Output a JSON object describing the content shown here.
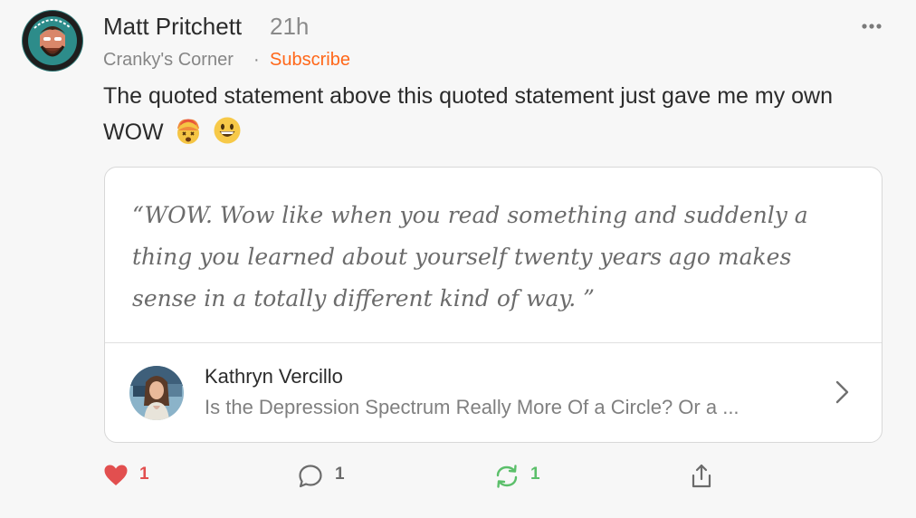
{
  "post": {
    "author": "Matt Pritchett",
    "timestamp": "21h",
    "publication": "Cranky's Corner",
    "separator": "·",
    "subscribe_label": "Subscribe",
    "body": "The quoted statement above this quoted statement just gave me my own WOW",
    "emojis": [
      "exploding-head-emoji",
      "grinning-face-emoji"
    ]
  },
  "quote": {
    "text": "“WOW. Wow like when you read something and suddenly a thing you learned about yourself twenty years ago makes sense in a totally different kind of way. ”",
    "source_author": "Kathryn Vercillo",
    "source_title": "Is the Depression Spectrum Really More Of a Circle? Or a ..."
  },
  "actions": {
    "like_count": "1",
    "comment_count": "1",
    "restack_count": "1"
  },
  "colors": {
    "accent": "#ff6719",
    "like": "#e24f4f",
    "restack": "#5bbf6a",
    "background": "#f7f7f7"
  },
  "icons": [
    "more-icon",
    "chevron-right-icon",
    "heart-icon",
    "comment-icon",
    "restack-icon",
    "share-icon"
  ]
}
